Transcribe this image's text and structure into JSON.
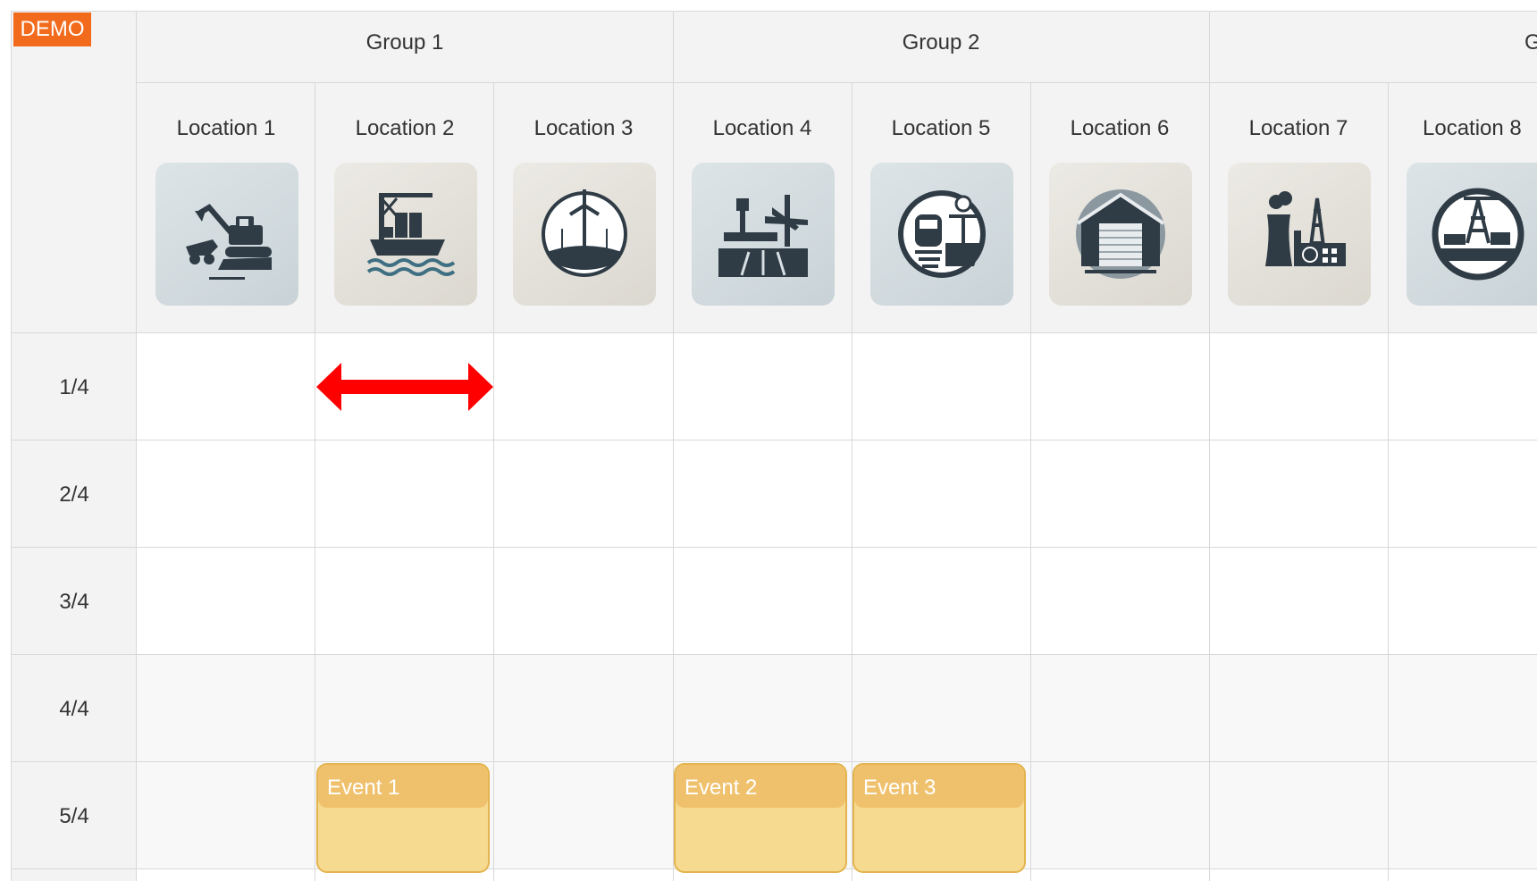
{
  "demo_badge": "DEMO",
  "groups": [
    {
      "label": "Group 1"
    },
    {
      "label": "Group 2"
    },
    {
      "label": "G"
    }
  ],
  "locations": [
    {
      "label": "Location 1",
      "icon": "excavator-mining-icon"
    },
    {
      "label": "Location 2",
      "icon": "cargo-ship-port-icon"
    },
    {
      "label": "Location 3",
      "icon": "wind-farm-icon"
    },
    {
      "label": "Location 4",
      "icon": "airport-runway-icon"
    },
    {
      "label": "Location 5",
      "icon": "train-station-icon"
    },
    {
      "label": "Location 6",
      "icon": "warehouse-icon"
    },
    {
      "label": "Location 7",
      "icon": "power-plant-icon"
    },
    {
      "label": "Location 8",
      "icon": "oil-rig-icon"
    }
  ],
  "rows": [
    {
      "label": "1/4"
    },
    {
      "label": "2/4"
    },
    {
      "label": "3/4"
    },
    {
      "label": "4/4"
    },
    {
      "label": "5/4"
    }
  ],
  "events": [
    {
      "label": "Event 1",
      "location": "Location 2",
      "row": "5/4"
    },
    {
      "label": "Event 2",
      "location": "Location 4",
      "row": "5/4"
    },
    {
      "label": "Event 3",
      "location": "Location 5",
      "row": "5/4"
    }
  ],
  "colors": {
    "demo_badge": "#f26a1b",
    "event_fill": "#f5da8f",
    "event_header": "#f0c16d",
    "resize_arrow": "#ff0000"
  }
}
